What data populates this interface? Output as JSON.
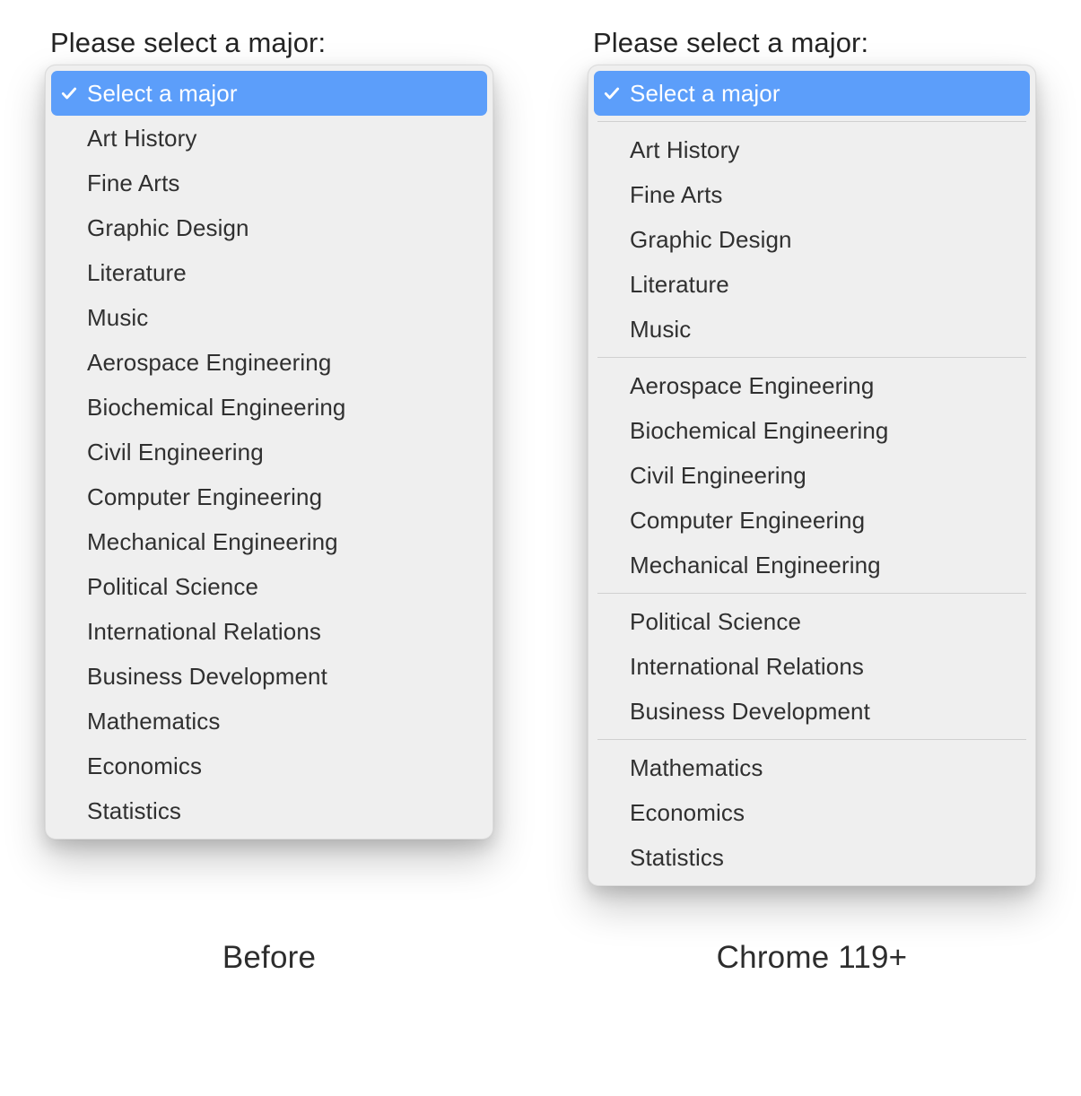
{
  "prompt": "Please select a major:",
  "selected_label": "Select a major",
  "left": {
    "caption": "Before",
    "options": [
      "Art History",
      "Fine Arts",
      "Graphic Design",
      "Literature",
      "Music",
      "Aerospace Engineering",
      "Biochemical Engineering",
      "Civil Engineering",
      "Computer Engineering",
      "Mechanical Engineering",
      "Political Science",
      "International Relations",
      "Business Development",
      "Mathematics",
      "Economics",
      "Statistics"
    ]
  },
  "right": {
    "caption": "Chrome 119+",
    "groups": [
      [
        "Art History",
        "Fine Arts",
        "Graphic Design",
        "Literature",
        "Music"
      ],
      [
        "Aerospace Engineering",
        "Biochemical Engineering",
        "Civil Engineering",
        "Computer Engineering",
        "Mechanical Engineering"
      ],
      [
        "Political Science",
        "International Relations",
        "Business Development"
      ],
      [
        "Mathematics",
        "Economics",
        "Statistics"
      ]
    ]
  }
}
